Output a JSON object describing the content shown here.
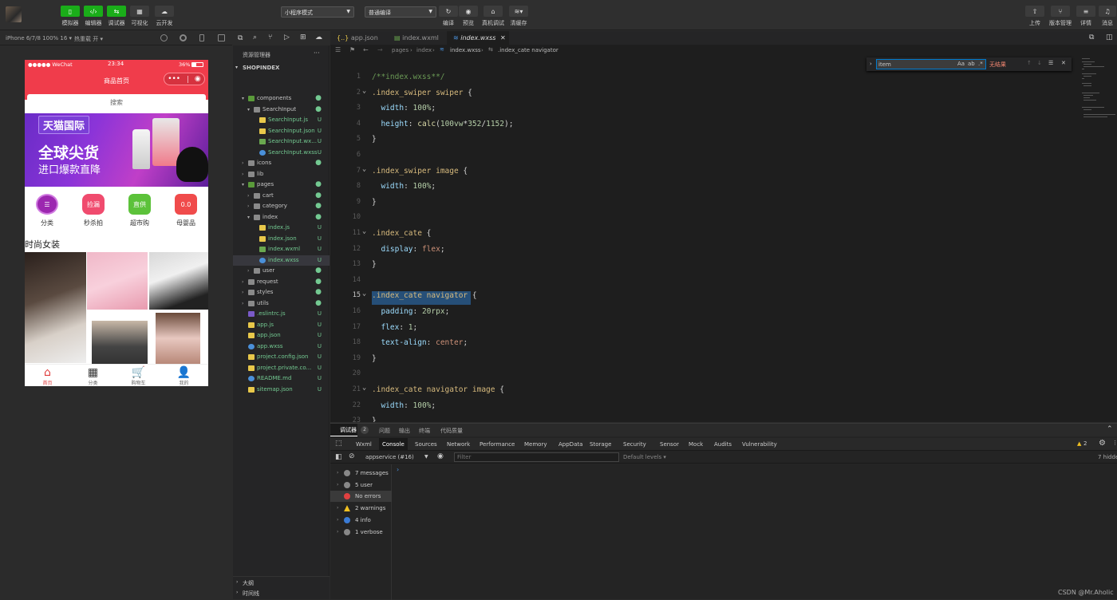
{
  "toolbar": {
    "left_buttons": [
      {
        "label": "模拟器",
        "icon": "phone-icon"
      },
      {
        "label": "编辑器",
        "icon": "code-icon"
      },
      {
        "label": "调试器",
        "icon": "debug-icon"
      },
      {
        "label": "可视化",
        "icon": "grid-icon"
      },
      {
        "label": "云开发",
        "icon": "cloud-icon"
      }
    ],
    "mode_select": "小程序模式",
    "compile_select": "普通编译",
    "mid_buttons": [
      {
        "label": "编译",
        "icon": "refresh-icon"
      },
      {
        "label": "预览",
        "icon": "eye-icon"
      },
      {
        "label": "真机调试",
        "icon": "device-icon"
      },
      {
        "label": "清缓存",
        "icon": "layers-icon"
      }
    ],
    "right_buttons": [
      {
        "label": "上传",
        "icon": "upload-icon"
      },
      {
        "label": "版本管理",
        "icon": "branch-icon"
      },
      {
        "label": "详情",
        "icon": "menu-icon"
      },
      {
        "label": "消息",
        "icon": "bell-icon"
      }
    ]
  },
  "simbar": {
    "device": "iPhone 6/7/8 100% 16 ▾",
    "hotreload": "热重载 开 ▾"
  },
  "phone": {
    "carrier": "●●●●● WeChat",
    "time": "23:34",
    "battery": "36%",
    "page_title": "商品首页",
    "search_placeholder": "搜索",
    "banner_tag": "天猫国际",
    "banner_line1": "全球尖货",
    "banner_line2": "进口爆款直降",
    "cats": [
      {
        "label": "分类",
        "badge": "☰",
        "color": "#9c27b0"
      },
      {
        "label": "秒杀拍",
        "badge": "捡漏",
        "color": "#f04b6e"
      },
      {
        "label": "超市购",
        "badge": "直供",
        "color": "#5cc23a"
      },
      {
        "label": "母婴品",
        "badge": "0.0",
        "color": "#f04b4b"
      }
    ],
    "section_title": "时尚女装",
    "tabs": [
      {
        "label": "首页",
        "icon": "home-icon",
        "glyph": "⌂"
      },
      {
        "label": "分类",
        "icon": "apps-icon",
        "glyph": "▦"
      },
      {
        "label": "购物车",
        "icon": "cart-icon",
        "glyph": "🛒"
      },
      {
        "label": "我的",
        "icon": "user-icon",
        "glyph": "👤"
      }
    ]
  },
  "explorer": {
    "title": "资源管理器",
    "project": "SHOPINDEX",
    "items": [
      {
        "name": "components",
        "type": "folder",
        "status": "dot",
        "indent": 1,
        "open": true
      },
      {
        "name": "SearchInput",
        "type": "folder",
        "status": "dot",
        "indent": 2,
        "open": true
      },
      {
        "name": "SearchInput.js",
        "type": "js",
        "status": "U",
        "indent": 3
      },
      {
        "name": "SearchInput.json",
        "type": "json",
        "status": "U",
        "indent": 3
      },
      {
        "name": "SearchInput.wx...",
        "type": "wxml",
        "status": "U",
        "indent": 3
      },
      {
        "name": "SearchInput.wxss",
        "type": "wxss",
        "status": "U",
        "indent": 3
      },
      {
        "name": "icons",
        "type": "folder",
        "status": "dot",
        "indent": 1,
        "open": false
      },
      {
        "name": "lib",
        "type": "folder",
        "status": "",
        "indent": 1,
        "open": false
      },
      {
        "name": "pages",
        "type": "folder",
        "status": "dot",
        "indent": 1,
        "open": true
      },
      {
        "name": "cart",
        "type": "folder",
        "status": "dot",
        "indent": 2,
        "open": false
      },
      {
        "name": "category",
        "type": "folder",
        "status": "dot",
        "indent": 2,
        "open": false
      },
      {
        "name": "index",
        "type": "folder",
        "status": "dot",
        "indent": 2,
        "open": true
      },
      {
        "name": "index.js",
        "type": "js",
        "status": "U",
        "indent": 3
      },
      {
        "name": "index.json",
        "type": "json",
        "status": "U",
        "indent": 3
      },
      {
        "name": "index.wxml",
        "type": "wxml",
        "status": "U",
        "indent": 3
      },
      {
        "name": "index.wxss",
        "type": "wxss",
        "status": "U",
        "indent": 3,
        "selected": true
      },
      {
        "name": "user",
        "type": "folder",
        "status": "dot",
        "indent": 2,
        "open": false
      },
      {
        "name": "request",
        "type": "folder",
        "status": "dot",
        "indent": 1,
        "open": false
      },
      {
        "name": "styles",
        "type": "folder",
        "status": "dot",
        "indent": 1,
        "open": false
      },
      {
        "name": "utils",
        "type": "folder",
        "status": "dot",
        "indent": 1,
        "open": false
      },
      {
        "name": ".eslintrc.js",
        "type": "eslint",
        "status": "U",
        "indent": 1
      },
      {
        "name": "app.js",
        "type": "js",
        "status": "U",
        "indent": 1
      },
      {
        "name": "app.json",
        "type": "json",
        "status": "U",
        "indent": 1
      },
      {
        "name": "app.wxss",
        "type": "wxss",
        "status": "U",
        "indent": 1
      },
      {
        "name": "project.config.json",
        "type": "json",
        "status": "U",
        "indent": 1
      },
      {
        "name": "project.private.co...",
        "type": "json",
        "status": "U",
        "indent": 1
      },
      {
        "name": "README.md",
        "type": "md",
        "status": "U",
        "indent": 1
      },
      {
        "name": "sitemap.json",
        "type": "json",
        "status": "U",
        "indent": 1
      }
    ],
    "outline": "大纲",
    "timeline": "时间线"
  },
  "editor": {
    "tabs": [
      {
        "label": "app.json",
        "icon": "json-icon"
      },
      {
        "label": "index.wxml",
        "icon": "wxml-icon"
      },
      {
        "label": "index.wxss",
        "icon": "wxss-icon",
        "active": true
      }
    ],
    "breadcrumb": [
      "pages",
      "index",
      "index.wxss",
      ".index_cate navigator"
    ],
    "find_value": "item",
    "find_result": "无结果",
    "current_line": 15
  },
  "devtools": {
    "top_tabs": [
      "调试器",
      "问题",
      "输出",
      "终端",
      "代码质量"
    ],
    "badge": "2",
    "panels": [
      "Wxml",
      "Console",
      "Sources",
      "Network",
      "Performance",
      "Memory",
      "AppData",
      "Storage",
      "Security",
      "Sensor",
      "Mock",
      "Audits",
      "Vulnerability"
    ],
    "active_panel": "Console",
    "warn_count": "2",
    "context": "appservice (#16)",
    "filter_placeholder": "Filter",
    "levels": "Default levels ▾",
    "hidden": "7 hidden",
    "side": [
      {
        "label": "7 messages",
        "color": "#888"
      },
      {
        "label": "5 user mess...",
        "color": "#888"
      },
      {
        "label": "No errors",
        "color": "#e04040"
      },
      {
        "label": "2 warnings",
        "color": "#f0c020"
      },
      {
        "label": "4 info",
        "color": "#3a7bd5"
      },
      {
        "label": "1 verbose",
        "color": "#888"
      }
    ]
  },
  "watermark": "CSDN @Mr.Aholic"
}
